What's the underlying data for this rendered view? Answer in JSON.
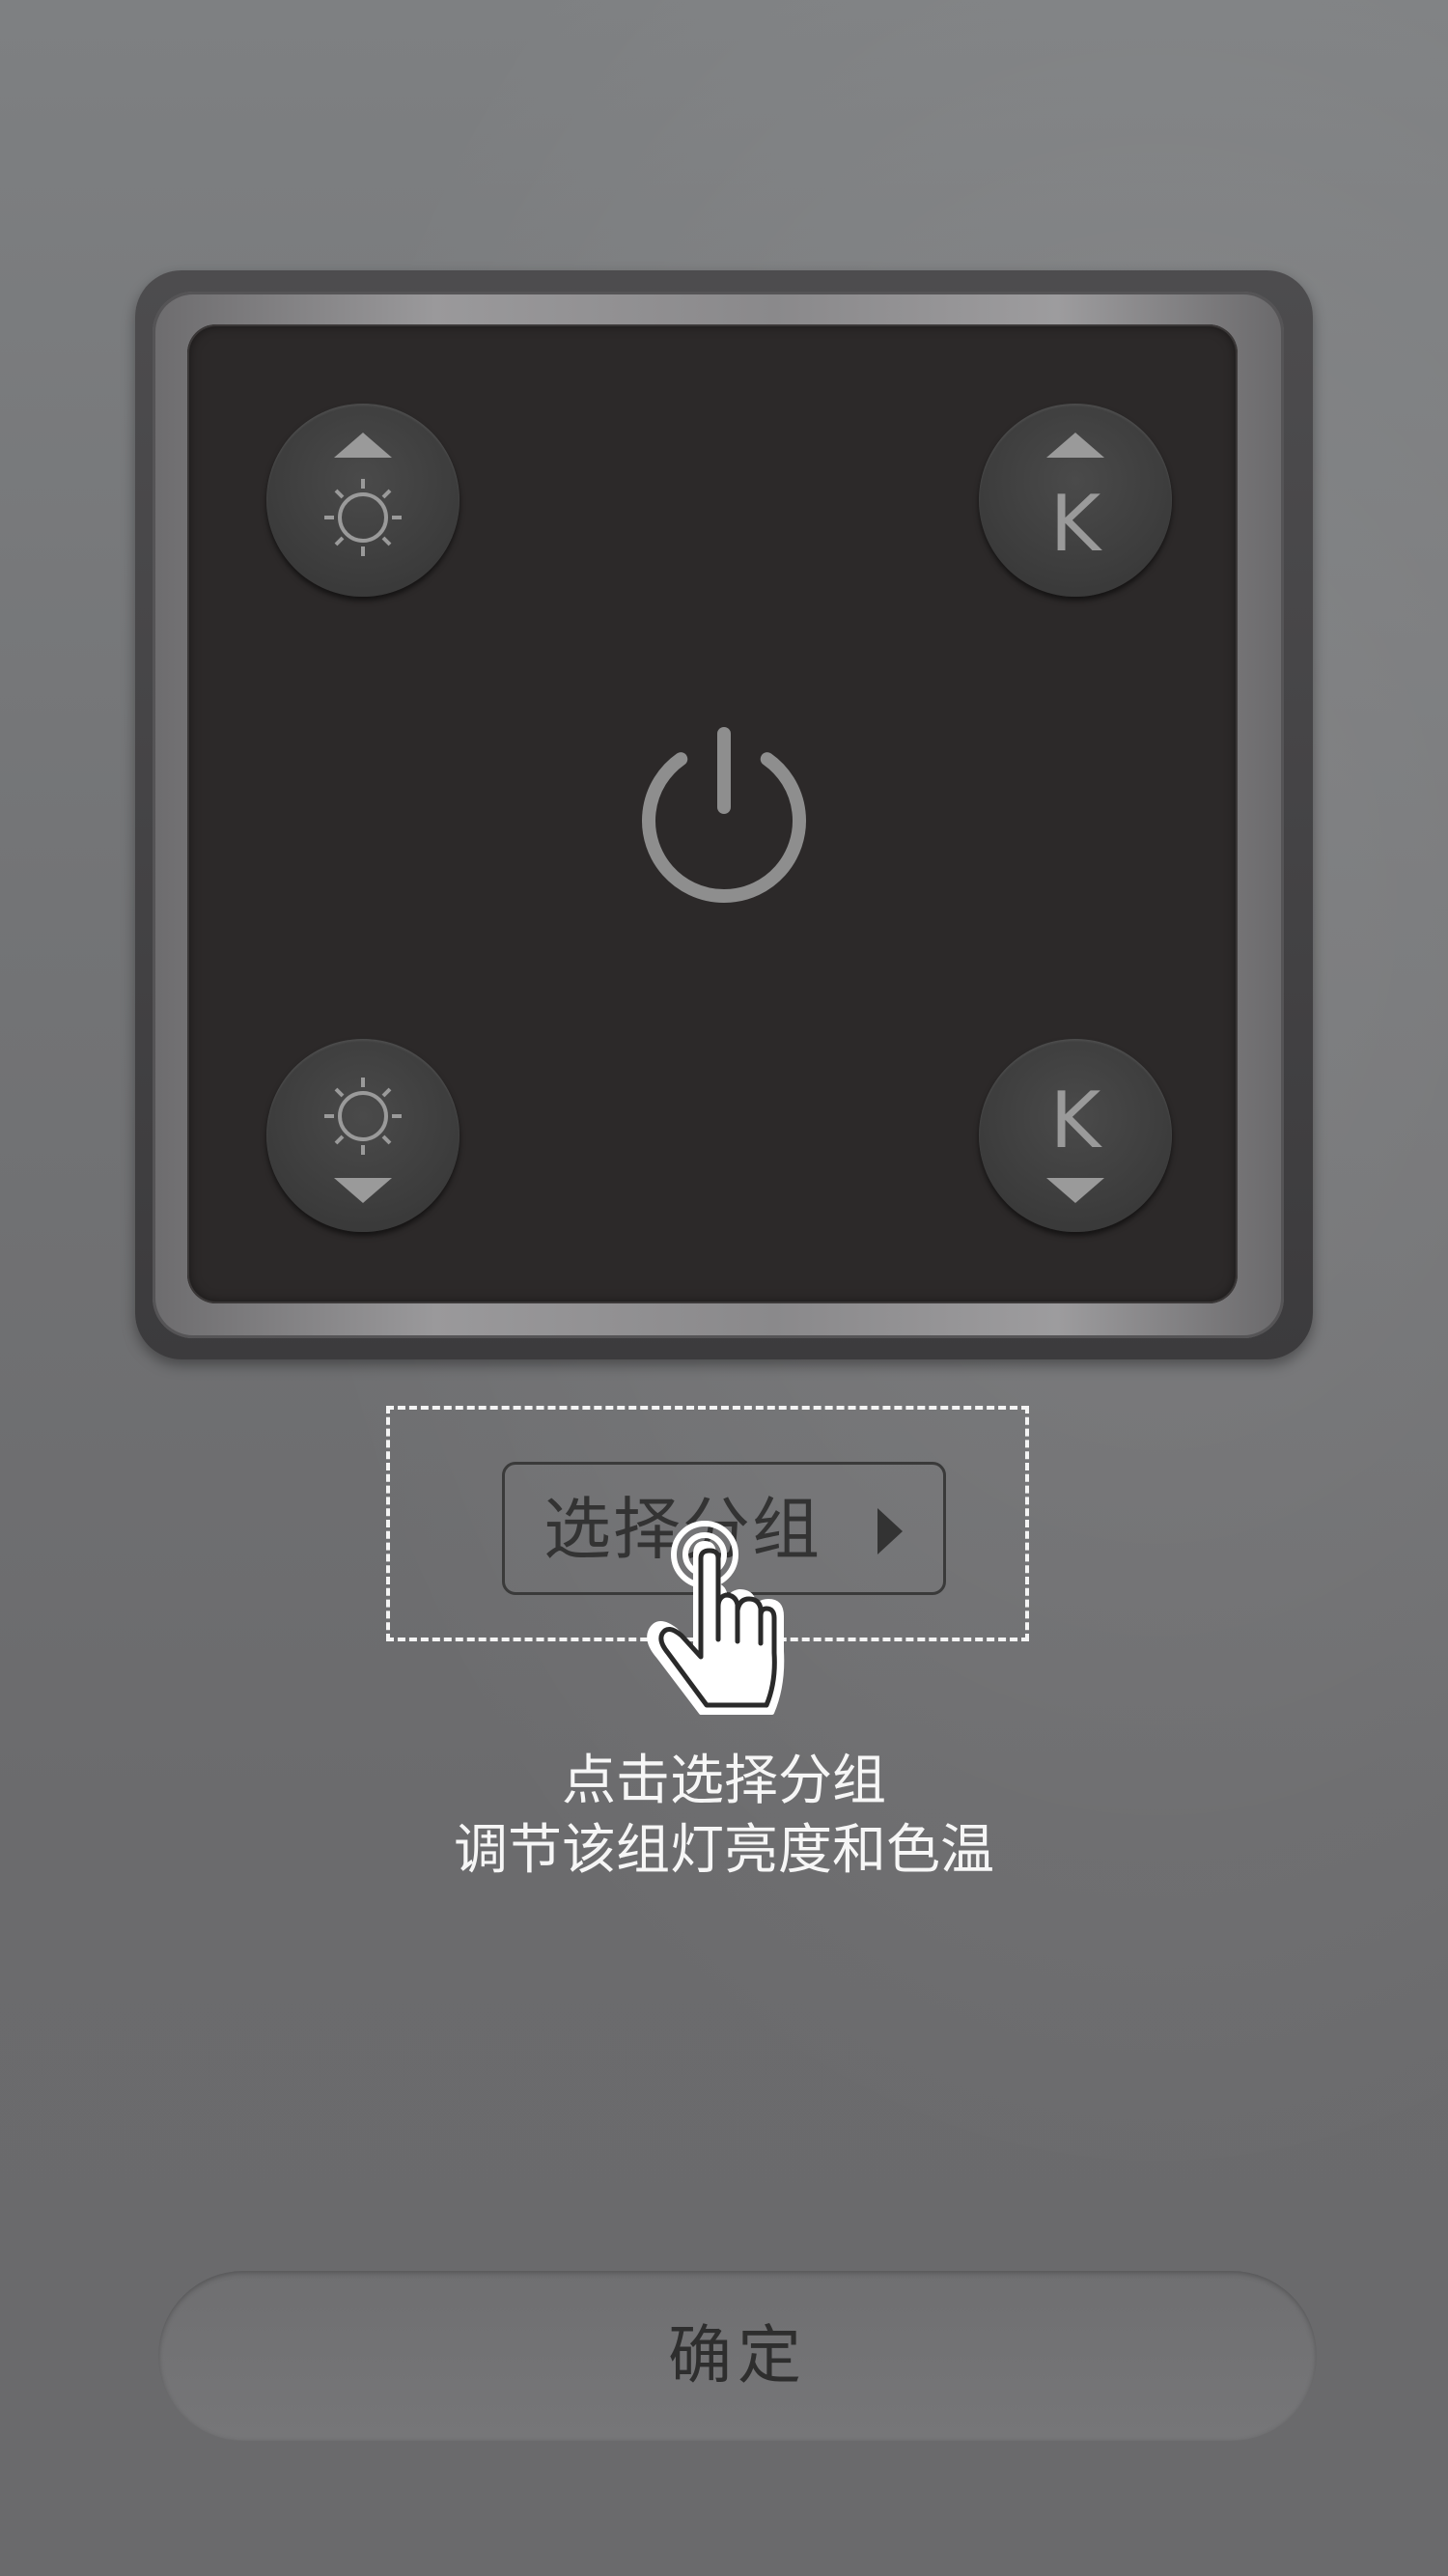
{
  "remote": {
    "brightness_up_icon": "brightness-up-icon",
    "brightness_down_icon": "brightness-down-icon",
    "color_temp_up_icon": "color-temp-up-icon",
    "color_temp_down_icon": "color-temp-down-icon",
    "power_icon": "power-icon",
    "temp_letter": "K"
  },
  "select_group": {
    "label": "选择分组",
    "arrow_icon": "triangle-right-icon",
    "pointer_icon": "tap-hand-icon"
  },
  "instructions": {
    "line1": "点击选择分组",
    "line2": "调节该组灯亮度和色温"
  },
  "confirm": {
    "label": "确定"
  },
  "colors": {
    "panel": "#2c2929",
    "button": "#3d3d3d",
    "icon": "#8e8e8e",
    "text_light": "#f6f6f6"
  }
}
